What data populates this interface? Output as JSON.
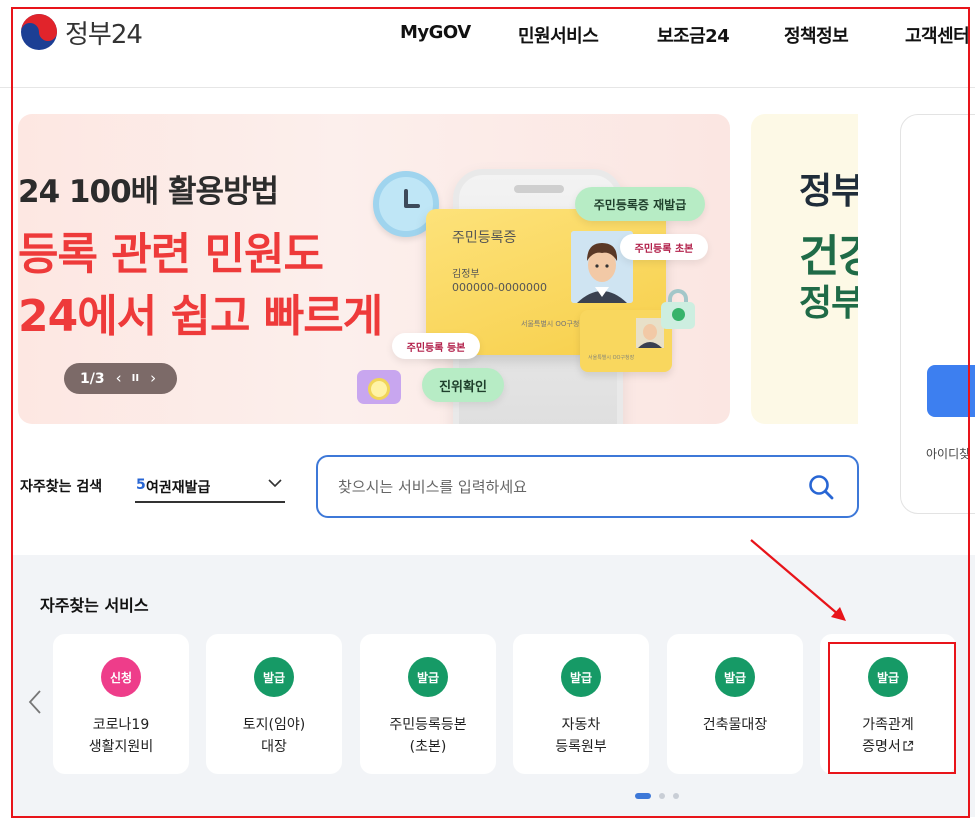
{
  "header": {
    "logo_text": "정부24",
    "nav": [
      {
        "label": "MyGOV"
      },
      {
        "label": "민원서비스"
      },
      {
        "label": "보조금24"
      },
      {
        "label": "정책정보"
      },
      {
        "label": "고객센터"
      }
    ]
  },
  "banner_main": {
    "line1": "24 100배 활용방법",
    "line2": "등록 관련 민원도",
    "line3": "24에서 쉽고 빠르게",
    "pager": {
      "current": "1/3",
      "prev": "‹",
      "pause": "II",
      "next": "›"
    },
    "id_card": {
      "title": "주민등록증",
      "name": "김정부",
      "number": "000000-0000000",
      "issuer": "서울특별시 OO구청장"
    },
    "pills": {
      "reissue": "주민등록증 재발급",
      "abstract": "주민등록 초본",
      "copy": "주민등록 등본",
      "verify": "진위확인"
    }
  },
  "banner_side": {
    "line1": "정부",
    "line2": "건강",
    "line3": "정부"
  },
  "login_panel": {
    "find_text": "아이디찾"
  },
  "search": {
    "label": "자주찾는 검색",
    "keyword_rank": "5",
    "keyword_text": "여권재발급",
    "placeholder": "찾으시는 서비스를 입력하세요"
  },
  "services": {
    "title": "자주찾는 서비스",
    "items": [
      {
        "badge": "신청",
        "line1": "코로나19",
        "line2": "생활지원비",
        "badge_color": "#ee3d8a"
      },
      {
        "badge": "발급",
        "line1": "토지(임야)",
        "line2": "대장",
        "badge_color": "#169a66"
      },
      {
        "badge": "발급",
        "line1": "주민등록등본",
        "line2": "(초본)",
        "badge_color": "#169a66"
      },
      {
        "badge": "발급",
        "line1": "자동차",
        "line2": "등록원부",
        "badge_color": "#169a66"
      },
      {
        "badge": "발급",
        "line1": "건축물대장",
        "line2": "",
        "badge_color": "#169a66"
      },
      {
        "badge": "발급",
        "line1": "가족관계",
        "line2": "증명서",
        "badge_color": "#169a66"
      }
    ]
  },
  "colors": {
    "accent_blue": "#3d78d8",
    "banner_red": "#ee3a3a",
    "annotation_red": "#e8141a"
  }
}
